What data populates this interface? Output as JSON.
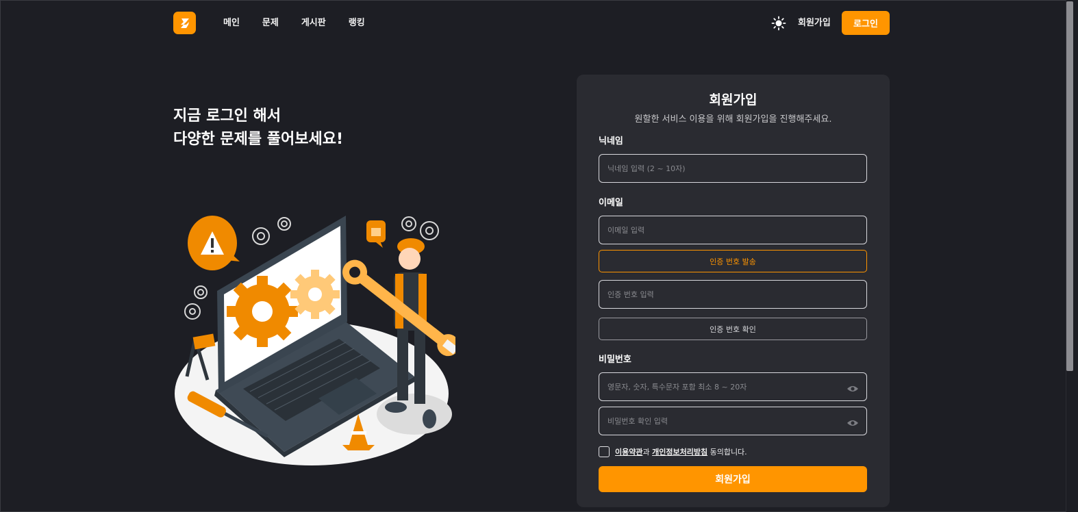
{
  "header": {
    "nav": [
      "메인",
      "문제",
      "게시판",
      "랭킹"
    ],
    "signup_label": "회원가입",
    "login_label": "로그인"
  },
  "hero": {
    "line1": "지금 로그인 해서",
    "line2": "다양한 문제를 풀어보세요!"
  },
  "signup": {
    "title": "회원가입",
    "subtitle": "원할한 서비스 이용을 위해 회원가입을 진행해주세요.",
    "nickname_label": "닉네임",
    "nickname_placeholder": "닉네임 입력 (2 ~ 10자)",
    "email_label": "이메일",
    "email_placeholder": "이메일 입력",
    "send_code_label": "인증 번호 발송",
    "code_placeholder": "인증 번호 입력",
    "verify_code_label": "인증 번호 확인",
    "password_label": "비밀번호",
    "password_placeholder": "영문자, 숫자, 특수문자 포함 최소 8 ~ 20자",
    "password_confirm_placeholder": "비밀번호 확인 입력",
    "terms_link": "이용약관",
    "terms_and": "과",
    "privacy_link": "개인정보처리방침",
    "agree_text": "동의합니다.",
    "submit_label": "회원가입"
  },
  "colors": {
    "accent": "#ff9500",
    "background": "#1d1e24",
    "card": "#2a2b31"
  }
}
